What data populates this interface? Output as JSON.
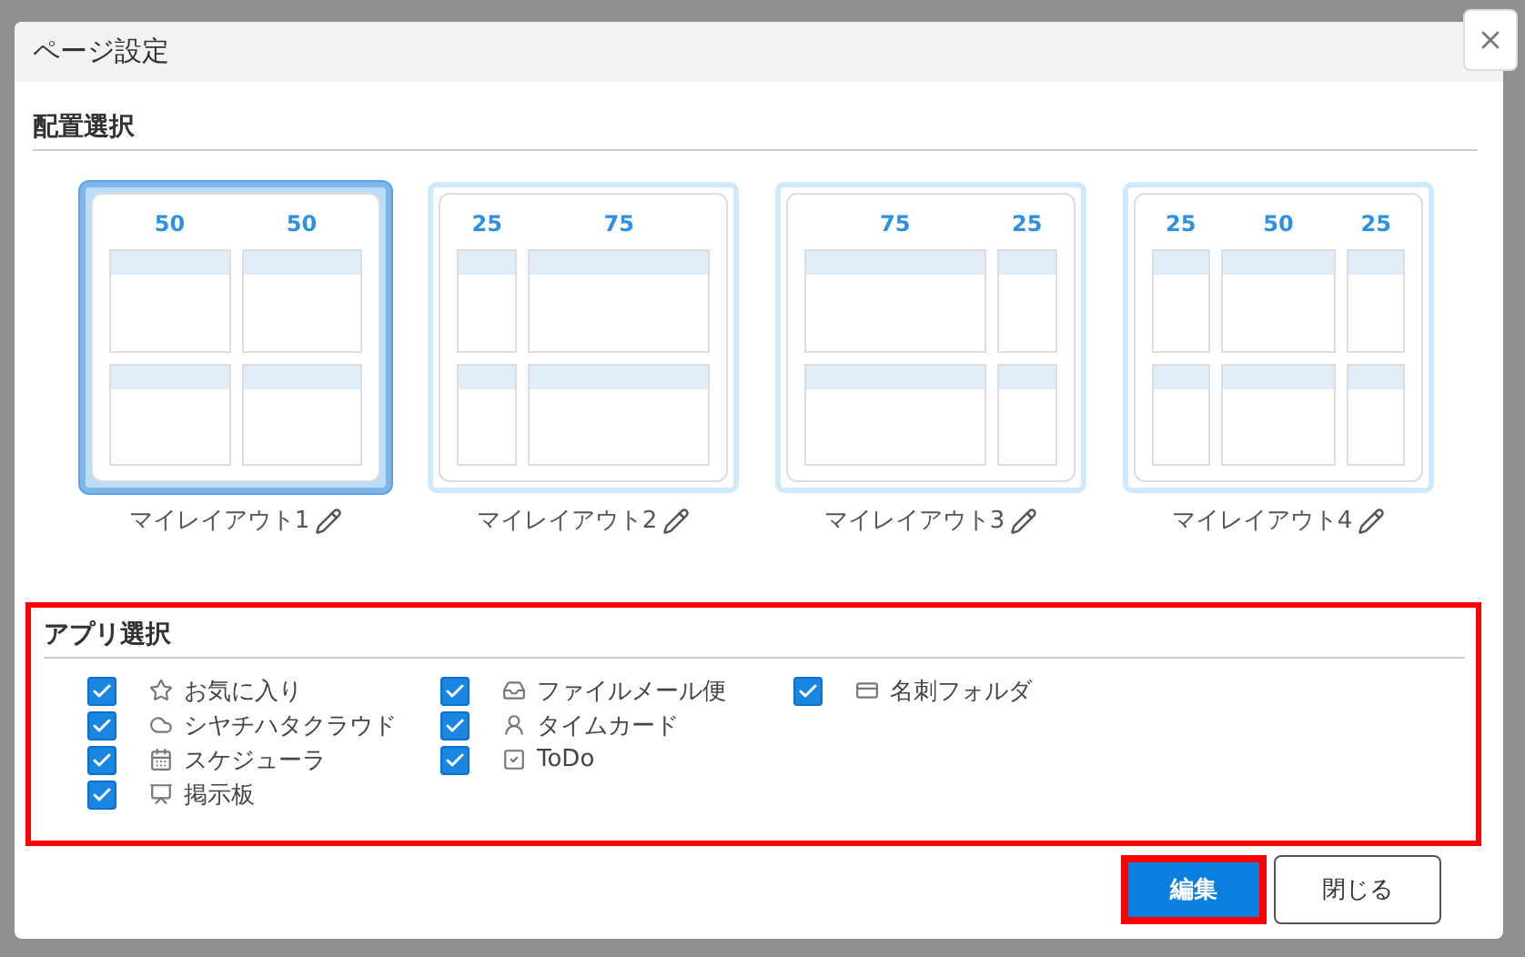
{
  "dialog": {
    "title": "ページ設定"
  },
  "layout_section": {
    "heading": "配置選択",
    "layouts": [
      {
        "name": "マイレイアウト1",
        "selected": true,
        "columns": [
          "50",
          "50"
        ]
      },
      {
        "name": "マイレイアウト2",
        "selected": false,
        "columns": [
          "25",
          "75"
        ]
      },
      {
        "name": "マイレイアウト3",
        "selected": false,
        "columns": [
          "75",
          "25"
        ]
      },
      {
        "name": "マイレイアウト4",
        "selected": false,
        "columns": [
          "25",
          "50",
          "25"
        ]
      }
    ]
  },
  "app_section": {
    "heading": "アプリ選択",
    "highlighted": true,
    "columns": [
      [
        {
          "label": "お気に入り",
          "checked": true,
          "kind": "star"
        },
        {
          "label": "シヤチハタクラウド",
          "checked": true,
          "kind": "cloud"
        },
        {
          "label": "スケジューラ",
          "checked": true,
          "kind": "calendar"
        },
        {
          "label": "掲示板",
          "checked": true,
          "kind": "board"
        }
      ],
      [
        {
          "label": "ファイルメール便",
          "checked": true,
          "kind": "tray"
        },
        {
          "label": "タイムカード",
          "checked": true,
          "kind": "person"
        },
        {
          "label": "ToDo",
          "checked": true,
          "kind": "todo"
        }
      ],
      [
        {
          "label": "名刺フォルダ",
          "checked": true,
          "kind": "card"
        }
      ]
    ]
  },
  "buttons": [
    {
      "label": "編集",
      "kind": "primary",
      "highlighted": true
    },
    {
      "label": "閉じる",
      "kind": "secondary",
      "highlighted": false
    }
  ]
}
